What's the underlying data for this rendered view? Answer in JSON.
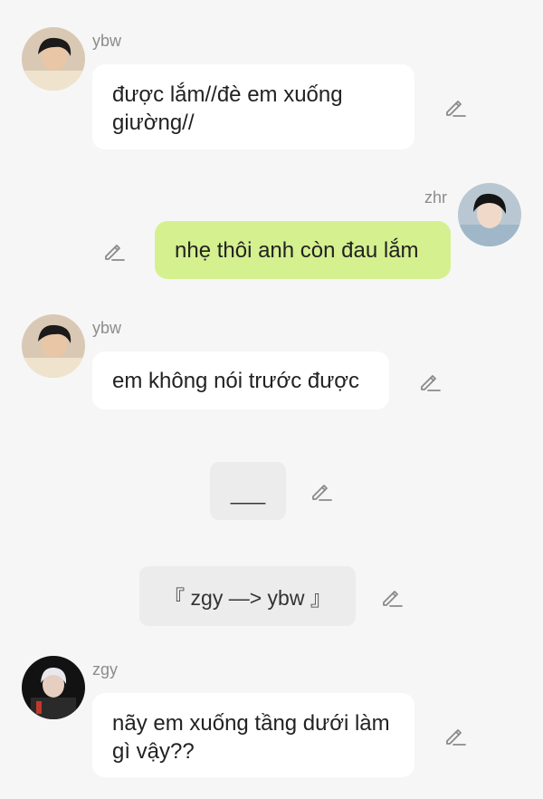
{
  "messages": [
    {
      "sender": "ybw",
      "text": "được lắm//đè em xuống giường//",
      "side": "left",
      "edit_icon": "pencil-icon"
    },
    {
      "sender": "zhr",
      "text": "nhẹ thôi anh còn đau lắm",
      "side": "right",
      "edit_icon": "pencil-icon"
    },
    {
      "sender": "ybw",
      "text": "em không nói trước được",
      "side": "left",
      "edit_icon": "pencil-icon"
    },
    {
      "sender": "zgy",
      "text": "nãy em xuống tầng dưới làm gì vậy??",
      "side": "left",
      "edit_icon": "pencil-icon"
    }
  ],
  "system_notes": [
    {
      "text": "___",
      "edit_icon": "pencil-icon"
    },
    {
      "text": "『 zgy —> ybw 』",
      "edit_icon": "pencil-icon"
    }
  ],
  "colors": {
    "background": "#f6f6f6",
    "bubble_left": "#ffffff",
    "bubble_right": "#d5f08f",
    "system_note": "#ececec",
    "sender_name": "#8c8c8c"
  }
}
